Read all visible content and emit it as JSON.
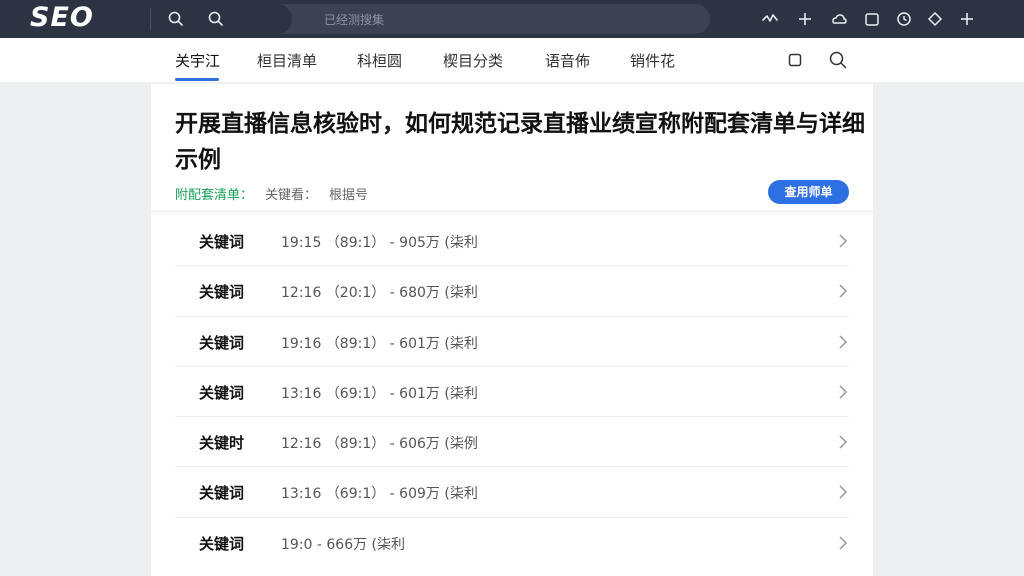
{
  "logo": "SEO",
  "search": {
    "placeholder": "已经测搜集"
  },
  "nav": {
    "items": [
      "关宇江",
      "桓目清单",
      "科桓圆",
      "楔目分类",
      "语音佈",
      "销件花"
    ],
    "active_index": 0
  },
  "article": {
    "title": "开展直播信息核验时，如何规范记录直播业绩宣称附配套清单与详细示例",
    "meta_green": "附配套清单：",
    "meta_a": "关键看：",
    "meta_b": "根据号",
    "cta_label": "查用师单"
  },
  "rows": [
    {
      "keyword": "关键词",
      "value": "19:15 （89:1） - 905万 (柒利"
    },
    {
      "keyword": "关键词",
      "value": "12:16 （20:1） - 680万 (柒利"
    },
    {
      "keyword": "关键词",
      "value": "19:16 （89:1） - 601万 (柒利"
    },
    {
      "keyword": "关键词",
      "value": "13:16 （69:1） - 601万 (柒利"
    },
    {
      "keyword": "关键时",
      "value": "12:16 （89:1） - 606万 (柒例"
    },
    {
      "keyword": "关键词",
      "value": "13:16 （69:1） - 609万 (柒利"
    },
    {
      "keyword": "关键词",
      "value": "19:0 - 666万 (柒利"
    }
  ],
  "colors": {
    "accent": "#2f6fe4",
    "topbar": "#2c3342",
    "green": "#1aa05a"
  },
  "icons": {
    "topbar_left": [
      "search-icon",
      "search-icon"
    ],
    "toolbar": [
      "activity-icon",
      "plus-icon",
      "cloud-icon",
      "folder-icon",
      "clock-icon",
      "diamond-icon",
      "plus-icon"
    ],
    "nav": [
      "square-icon",
      "search-icon"
    ]
  }
}
